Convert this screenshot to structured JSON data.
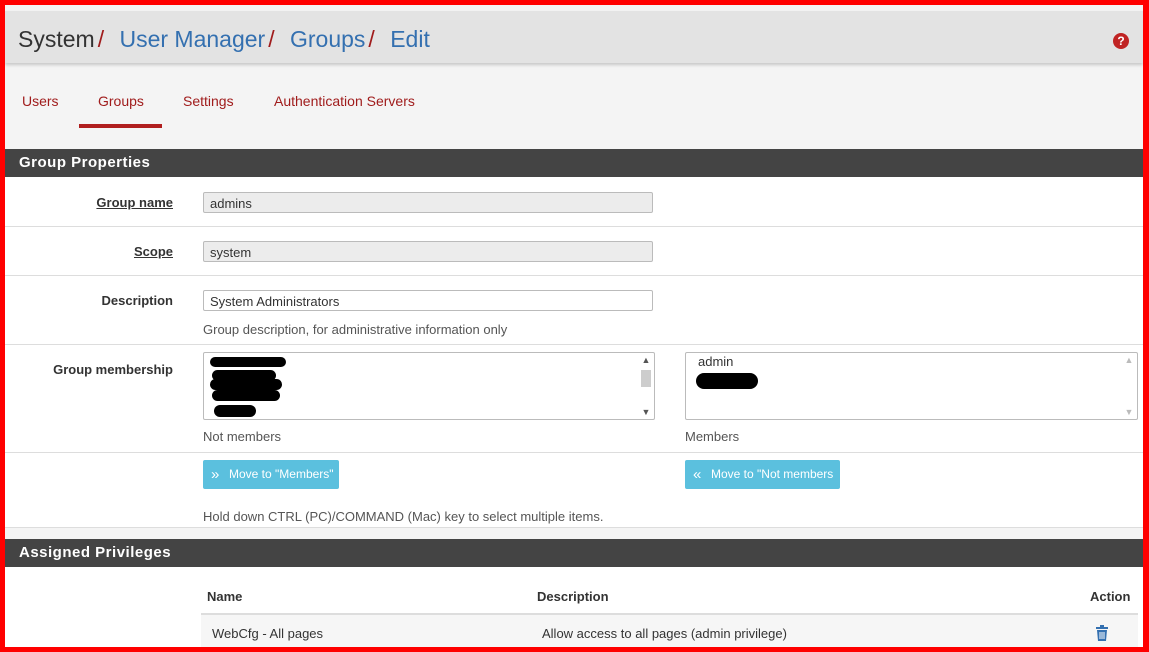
{
  "breadcrumb": {
    "root": "System",
    "items": [
      "User Manager",
      "Groups",
      "Edit"
    ],
    "separator": "/"
  },
  "help_icon": "?",
  "tabs": [
    {
      "label": "Users",
      "active": false
    },
    {
      "label": "Groups",
      "active": true
    },
    {
      "label": "Settings",
      "active": false
    },
    {
      "label": "Authentication Servers",
      "active": false
    }
  ],
  "group_properties": {
    "heading": "Group Properties",
    "group_name": {
      "label": "Group name",
      "value": "admins"
    },
    "scope": {
      "label": "Scope",
      "value": "system"
    },
    "description": {
      "label": "Description",
      "value": "System Administrators",
      "help": "Group description, for administrative information only"
    },
    "membership": {
      "label": "Group membership",
      "not_members_caption": "Not members",
      "members_caption": "Members",
      "members": [
        "admin"
      ],
      "move_to_members": "Move to \"Members\"",
      "move_to_not_members": "Move to \"Not members",
      "help": "Hold down CTRL (PC)/COMMAND (Mac) key to select multiple items."
    }
  },
  "assigned_privileges": {
    "heading": "Assigned Privileges",
    "columns": [
      "Name",
      "Description",
      "Action"
    ],
    "rows": [
      {
        "name": "WebCfg - All pages",
        "description": "Allow access to all pages (admin privilege)",
        "action_icon": "trash-icon"
      }
    ]
  },
  "colors": {
    "frame": "#ff0000",
    "link": "#3470b0",
    "accent": "#a01c1c",
    "button": "#5bc0de",
    "panel_header": "#444444"
  }
}
